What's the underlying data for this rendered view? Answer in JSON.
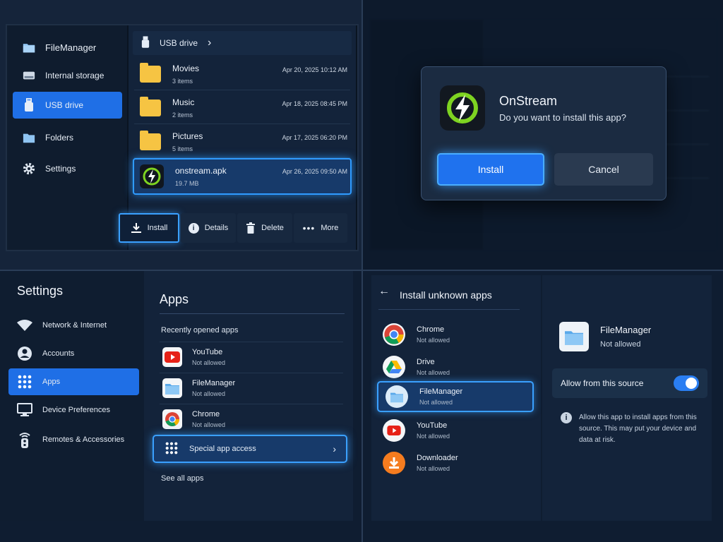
{
  "file_manager": {
    "app_title": "FileManager",
    "nav": [
      {
        "label": "Internal storage",
        "icon": "drive-icon"
      },
      {
        "label": "USB drive",
        "icon": "usb-icon",
        "active": true
      },
      {
        "label": "Folders",
        "icon": "folder-icon"
      },
      {
        "label": "Settings",
        "icon": "gear-icon"
      }
    ],
    "breadcrumb": {
      "label": "USB drive",
      "chevron": "›"
    },
    "files": [
      {
        "name": "Movies",
        "sub": "3 items",
        "date": "Apr 20, 2025   10:12 AM"
      },
      {
        "name": "Music",
        "sub": "2 items",
        "date": "Apr 18, 2025   08:45 PM"
      },
      {
        "name": "Pictures",
        "sub": "5 items",
        "date": "Apr 17, 2025   06:20 PM"
      }
    ],
    "apk": {
      "name": "onstream.apk",
      "sub": "19.7 MB",
      "date": "Apr 26, 2025   09:50 AM"
    },
    "actions": {
      "install": "Install",
      "details": "Details",
      "delete": "Delete",
      "more": "More"
    }
  },
  "dialog": {
    "app_name": "OnStream",
    "question": "Do you want to install this app?",
    "install": "Install",
    "cancel": "Cancel"
  },
  "settings": {
    "title": "Settings",
    "nav": [
      {
        "label": "Network & Internet",
        "icon": "wifi-icon"
      },
      {
        "label": "Accounts",
        "icon": "account-icon"
      },
      {
        "label": "Apps",
        "icon": "apps-grid-icon",
        "active": true
      },
      {
        "label": "Device Preferences",
        "icon": "monitor-icon"
      },
      {
        "label": "Remotes & Accessories",
        "icon": "remote-icon"
      }
    ],
    "apps_title": "Apps",
    "recent_label": "Recently opened apps",
    "recent": [
      {
        "name": "YouTube",
        "status": "Not allowed",
        "icon": "youtube-icon"
      },
      {
        "name": "FileManager",
        "status": "Not allowed",
        "icon": "filemanager-icon"
      },
      {
        "name": "Chrome",
        "status": "Not allowed",
        "icon": "chrome-icon"
      }
    ],
    "special_access": "Special app access",
    "see_all": "See all apps"
  },
  "install_unknown": {
    "title": "Install unknown apps",
    "apps": [
      {
        "name": "Chrome",
        "status": "Not allowed",
        "icon": "chrome-icon"
      },
      {
        "name": "Drive",
        "status": "Not allowed",
        "icon": "drive-app-icon"
      },
      {
        "name": "FileManager",
        "status": "Not allowed",
        "icon": "filemanager-icon",
        "selected": true
      },
      {
        "name": "YouTube",
        "status": "Not allowed",
        "icon": "youtube-icon"
      },
      {
        "name": "Downloader",
        "status": "Not allowed",
        "icon": "downloader-icon"
      }
    ],
    "detail": {
      "name": "FileManager",
      "status": "Not allowed",
      "allow_label": "Allow from this source",
      "allow_on": true,
      "info": "Allow this app to install apps from this source. This may put your device and data at risk."
    }
  },
  "colors": {
    "accent": "#1f6fe6",
    "glow": "#3aa0ff",
    "folder": "#f6c443",
    "apk_green": "#7ed321"
  }
}
